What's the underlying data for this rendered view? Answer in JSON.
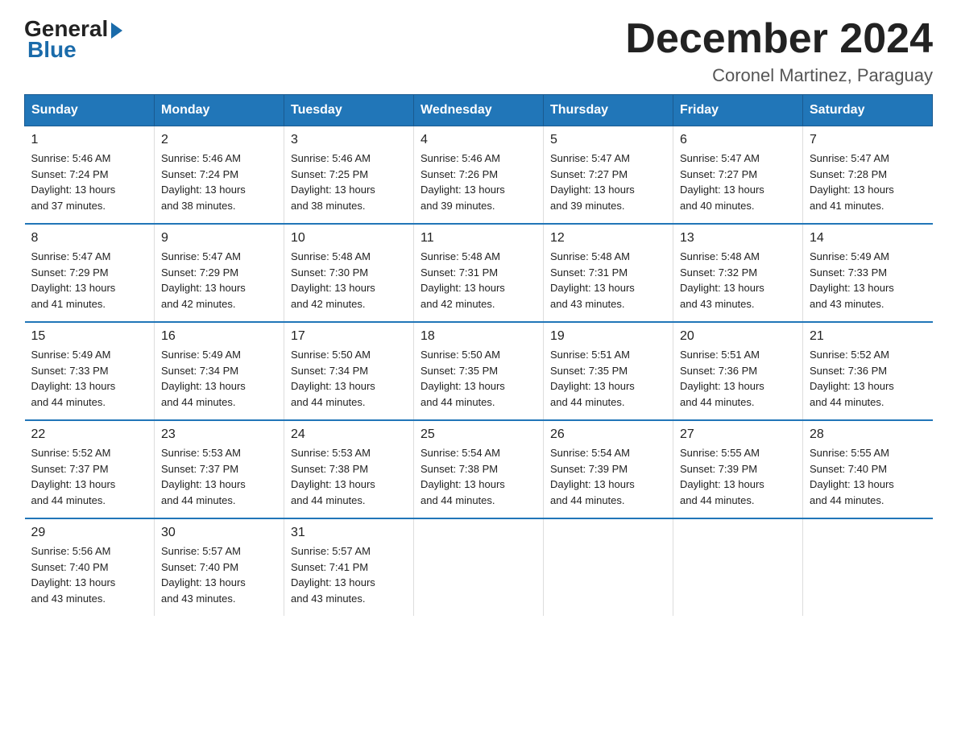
{
  "logo": {
    "general": "General",
    "blue": "Blue"
  },
  "title": "December 2024",
  "subtitle": "Coronel Martinez, Paraguay",
  "header_color": "#2176b8",
  "days": [
    "Sunday",
    "Monday",
    "Tuesday",
    "Wednesday",
    "Thursday",
    "Friday",
    "Saturday"
  ],
  "weeks": [
    [
      {
        "day": "1",
        "sunrise": "5:46 AM",
        "sunset": "7:24 PM",
        "daylight": "13 hours and 37 minutes."
      },
      {
        "day": "2",
        "sunrise": "5:46 AM",
        "sunset": "7:24 PM",
        "daylight": "13 hours and 38 minutes."
      },
      {
        "day": "3",
        "sunrise": "5:46 AM",
        "sunset": "7:25 PM",
        "daylight": "13 hours and 38 minutes."
      },
      {
        "day": "4",
        "sunrise": "5:46 AM",
        "sunset": "7:26 PM",
        "daylight": "13 hours and 39 minutes."
      },
      {
        "day": "5",
        "sunrise": "5:47 AM",
        "sunset": "7:27 PM",
        "daylight": "13 hours and 39 minutes."
      },
      {
        "day": "6",
        "sunrise": "5:47 AM",
        "sunset": "7:27 PM",
        "daylight": "13 hours and 40 minutes."
      },
      {
        "day": "7",
        "sunrise": "5:47 AM",
        "sunset": "7:28 PM",
        "daylight": "13 hours and 41 minutes."
      }
    ],
    [
      {
        "day": "8",
        "sunrise": "5:47 AM",
        "sunset": "7:29 PM",
        "daylight": "13 hours and 41 minutes."
      },
      {
        "day": "9",
        "sunrise": "5:47 AM",
        "sunset": "7:29 PM",
        "daylight": "13 hours and 42 minutes."
      },
      {
        "day": "10",
        "sunrise": "5:48 AM",
        "sunset": "7:30 PM",
        "daylight": "13 hours and 42 minutes."
      },
      {
        "day": "11",
        "sunrise": "5:48 AM",
        "sunset": "7:31 PM",
        "daylight": "13 hours and 42 minutes."
      },
      {
        "day": "12",
        "sunrise": "5:48 AM",
        "sunset": "7:31 PM",
        "daylight": "13 hours and 43 minutes."
      },
      {
        "day": "13",
        "sunrise": "5:48 AM",
        "sunset": "7:32 PM",
        "daylight": "13 hours and 43 minutes."
      },
      {
        "day": "14",
        "sunrise": "5:49 AM",
        "sunset": "7:33 PM",
        "daylight": "13 hours and 43 minutes."
      }
    ],
    [
      {
        "day": "15",
        "sunrise": "5:49 AM",
        "sunset": "7:33 PM",
        "daylight": "13 hours and 44 minutes."
      },
      {
        "day": "16",
        "sunrise": "5:49 AM",
        "sunset": "7:34 PM",
        "daylight": "13 hours and 44 minutes."
      },
      {
        "day": "17",
        "sunrise": "5:50 AM",
        "sunset": "7:34 PM",
        "daylight": "13 hours and 44 minutes."
      },
      {
        "day": "18",
        "sunrise": "5:50 AM",
        "sunset": "7:35 PM",
        "daylight": "13 hours and 44 minutes."
      },
      {
        "day": "19",
        "sunrise": "5:51 AM",
        "sunset": "7:35 PM",
        "daylight": "13 hours and 44 minutes."
      },
      {
        "day": "20",
        "sunrise": "5:51 AM",
        "sunset": "7:36 PM",
        "daylight": "13 hours and 44 minutes."
      },
      {
        "day": "21",
        "sunrise": "5:52 AM",
        "sunset": "7:36 PM",
        "daylight": "13 hours and 44 minutes."
      }
    ],
    [
      {
        "day": "22",
        "sunrise": "5:52 AM",
        "sunset": "7:37 PM",
        "daylight": "13 hours and 44 minutes."
      },
      {
        "day": "23",
        "sunrise": "5:53 AM",
        "sunset": "7:37 PM",
        "daylight": "13 hours and 44 minutes."
      },
      {
        "day": "24",
        "sunrise": "5:53 AM",
        "sunset": "7:38 PM",
        "daylight": "13 hours and 44 minutes."
      },
      {
        "day": "25",
        "sunrise": "5:54 AM",
        "sunset": "7:38 PM",
        "daylight": "13 hours and 44 minutes."
      },
      {
        "day": "26",
        "sunrise": "5:54 AM",
        "sunset": "7:39 PM",
        "daylight": "13 hours and 44 minutes."
      },
      {
        "day": "27",
        "sunrise": "5:55 AM",
        "sunset": "7:39 PM",
        "daylight": "13 hours and 44 minutes."
      },
      {
        "day": "28",
        "sunrise": "5:55 AM",
        "sunset": "7:40 PM",
        "daylight": "13 hours and 44 minutes."
      }
    ],
    [
      {
        "day": "29",
        "sunrise": "5:56 AM",
        "sunset": "7:40 PM",
        "daylight": "13 hours and 43 minutes."
      },
      {
        "day": "30",
        "sunrise": "5:57 AM",
        "sunset": "7:40 PM",
        "daylight": "13 hours and 43 minutes."
      },
      {
        "day": "31",
        "sunrise": "5:57 AM",
        "sunset": "7:41 PM",
        "daylight": "13 hours and 43 minutes."
      },
      null,
      null,
      null,
      null
    ]
  ],
  "labels": {
    "sunrise": "Sunrise:",
    "sunset": "Sunset:",
    "daylight": "Daylight:"
  }
}
